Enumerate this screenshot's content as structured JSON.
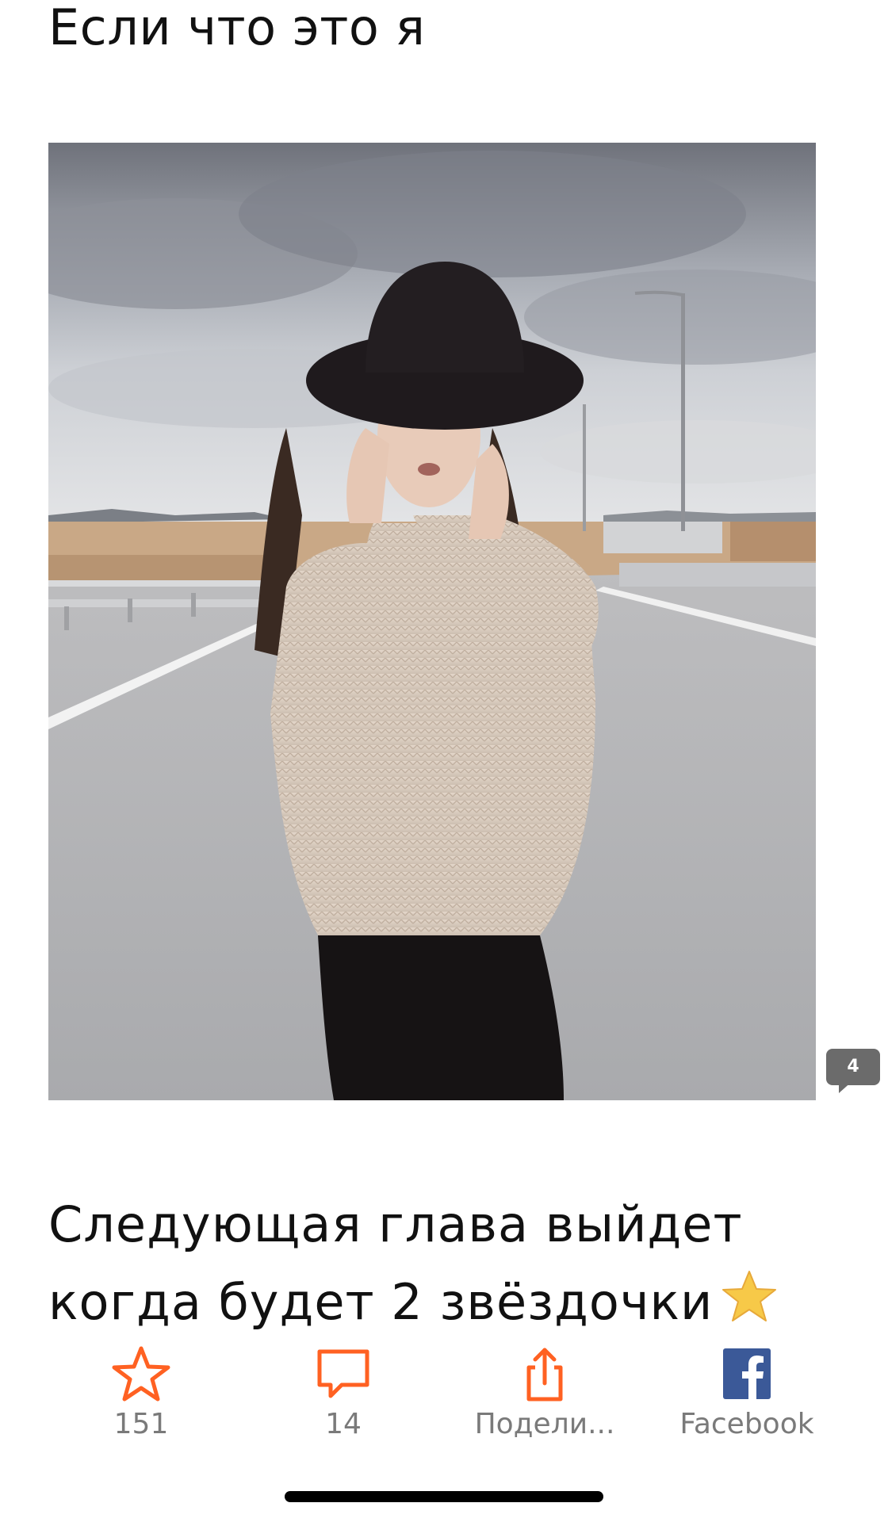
{
  "story": {
    "top_text": "Если что это я",
    "next_chapter_text": "Следующая глава выйдет когда будет 2 звёздочки"
  },
  "inline_comment": {
    "count": "4"
  },
  "actions": {
    "vote": {
      "label": "151",
      "icon": "star-outline-icon"
    },
    "comments": {
      "label": "14",
      "icon": "comment-bubble-icon"
    },
    "share": {
      "label": "Подели...",
      "icon": "share-icon"
    },
    "facebook": {
      "label": "Facebook",
      "icon": "facebook-icon"
    }
  },
  "colors": {
    "accent": "#ff6122",
    "facebook": "#3b5998",
    "label_gray": "#7a7a7a",
    "comment_marker": "#6b6b6b"
  }
}
